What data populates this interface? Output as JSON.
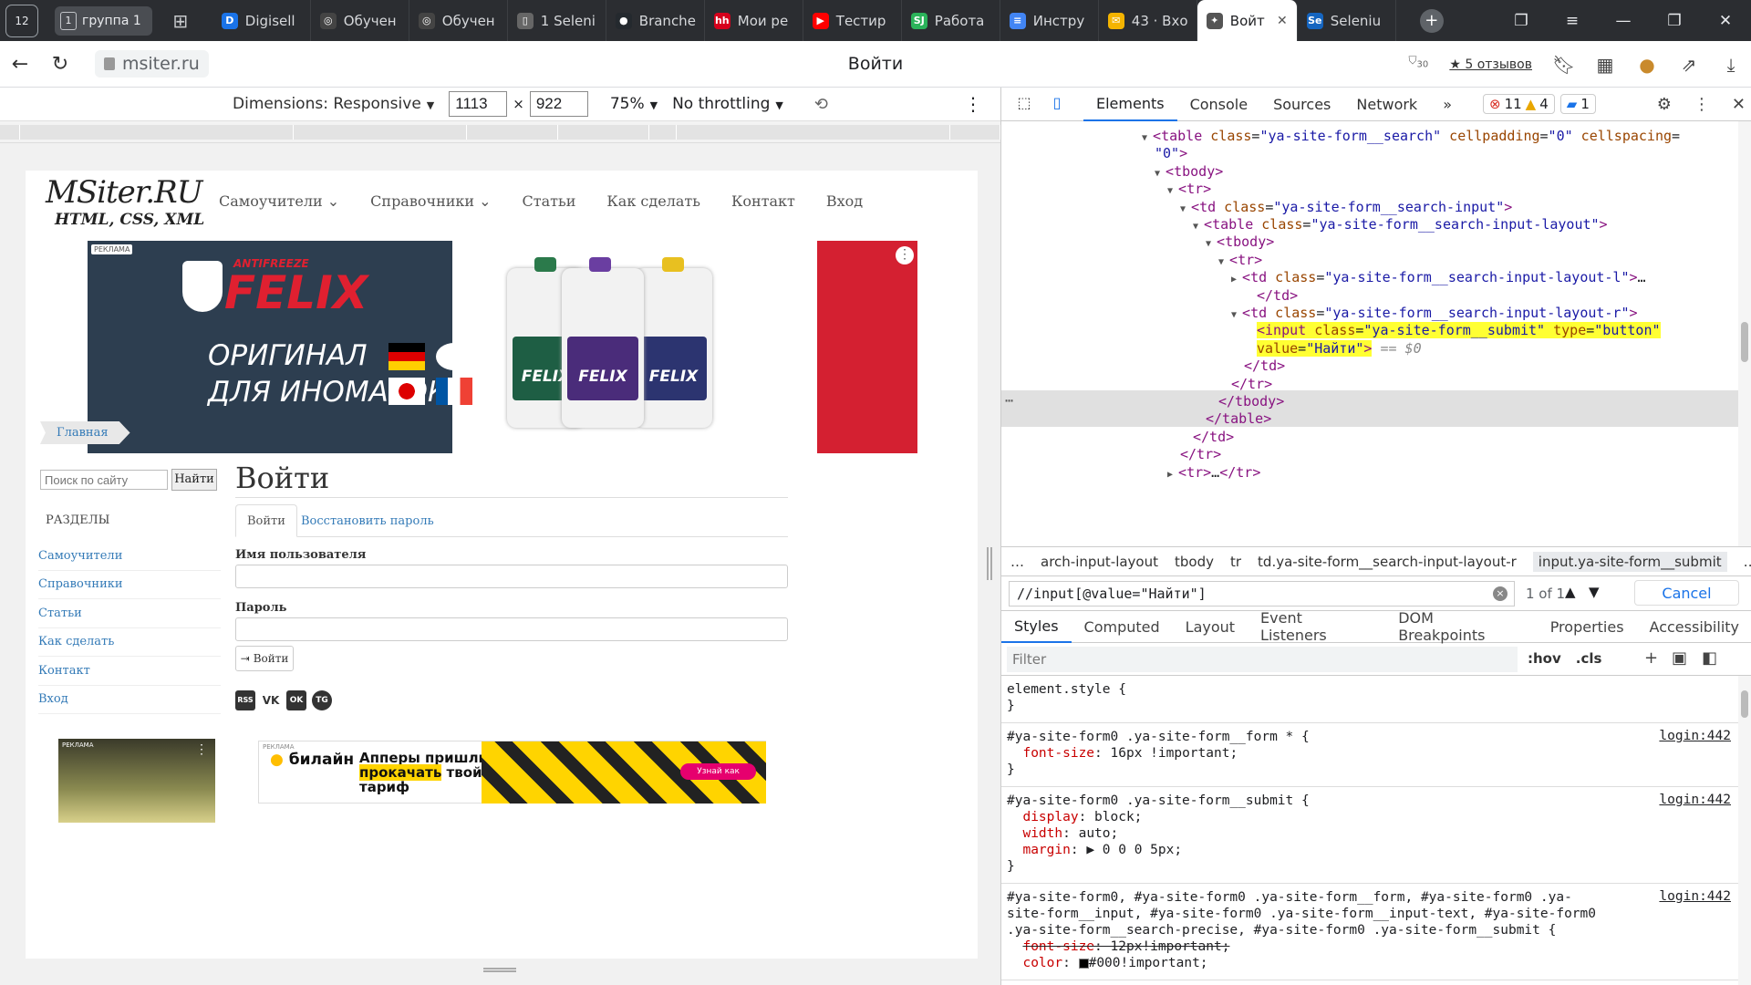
{
  "browser": {
    "home_badge": "12",
    "group": {
      "count": "1",
      "label": "группа 1"
    },
    "tabs": [
      {
        "label": "Digisell",
        "fav": "D",
        "color": "#1a73e8"
      },
      {
        "label": "Обучен",
        "fav": "◎",
        "color": "#444"
      },
      {
        "label": "Обучен",
        "fav": "◎",
        "color": "#444"
      },
      {
        "label": "1 Seleni",
        "fav": "▯",
        "color": "#666"
      },
      {
        "label": "Branche",
        "fav": "●",
        "color": "#24292e"
      },
      {
        "label": "Мои ре",
        "fav": "hh",
        "color": "#d6001c"
      },
      {
        "label": "Тестир",
        "fav": "▶",
        "color": "#ff0000"
      },
      {
        "label": "Работа",
        "fav": "SJ",
        "color": "#2bb35a"
      },
      {
        "label": "Инстру",
        "fav": "≡",
        "color": "#4285f4"
      },
      {
        "label": "43 · Вхо",
        "fav": "✉",
        "color": "#f4b400"
      },
      {
        "label": "Войт",
        "fav": "✦",
        "color": "#555"
      },
      {
        "label": "Seleniu",
        "fav": "Se",
        "color": "#1565c0"
      }
    ],
    "url": "msiter.ru",
    "page_title": "Войти",
    "reviews": "★ 5 отзывов",
    "ext_badge": "30"
  },
  "device_toolbar": {
    "dimensions_label": "Dimensions: Responsive",
    "width": "1113",
    "height": "922",
    "zoom": "75%",
    "throttling": "No throttling",
    "times": "×"
  },
  "site": {
    "logo_line1": "MSiter.RU",
    "logo_line2": "HTML, CSS, XML",
    "menu": [
      "Самоучители ⌄",
      "Справочники ⌄",
      "Статьи",
      "Как сделать",
      "Контакт",
      "Вход"
    ],
    "ad_felix": {
      "reklama": "РЕКЛАМА",
      "antifreeze": "ANTIFREEZE",
      "brand": "FELIX",
      "line1": "ОРИГИНАЛ",
      "line2": "ДЛЯ ИНОМАРОК",
      "bottles": [
        "FELIX",
        "FELIX",
        "FELIX"
      ]
    },
    "breadcrumb": "Главная",
    "search_placeholder": "Поиск по сайту",
    "search_button": "Найти",
    "sections_title": "РАЗДЕЛЫ",
    "side_links": [
      "Самоучители",
      "Справочники",
      "Статьи",
      "Как сделать",
      "Контакт",
      "Вход"
    ],
    "login_heading": "Войти",
    "tab_login": "Войти",
    "tab_restore": "Восстановить пароль",
    "username_label": "Имя пользователя",
    "password_label": "Пароль",
    "login_button": "Войти",
    "socials": [
      "RSS",
      "VK",
      "OK",
      "TG"
    ],
    "ad_beeline": {
      "reklama": "РЕКЛАМА",
      "logo": "билайн",
      "text1": "Апперы пришли",
      "text2a": "прокачать",
      "text2b": " твой",
      "text3": "тариф",
      "cta": "Узнай как"
    },
    "ad_left_reklama": "РЕКЛАМА"
  },
  "devtools": {
    "tabs": [
      "Elements",
      "Console",
      "Sources",
      "Network"
    ],
    "more": "»",
    "errors": "11",
    "warnings": "4",
    "messages": "1",
    "dom_lines": [
      {
        "indent": 0,
        "arrow": "▼",
        "html": "<span class=\"tag\">&lt;table</span> <span class=\"attr\">class</span>=<span class=\"val\">\"ya-site-form__search\"</span> <span class=\"attr\">cellpadding</span>=<span class=\"val\">\"0\"</span> <span class=\"attr\">cellspacing</span>="
      },
      {
        "indent": 0,
        "arrow": "",
        "html": "<span class=\"val\">\"0\"</span><span class=\"tag\">&gt;</span>"
      },
      {
        "indent": 1,
        "arrow": "▼",
        "html": "<span class=\"tag\">&lt;tbody&gt;</span>"
      },
      {
        "indent": 2,
        "arrow": "▼",
        "html": "<span class=\"tag\">&lt;tr&gt;</span>"
      },
      {
        "indent": 3,
        "arrow": "▼",
        "html": "<span class=\"tag\">&lt;td</span> <span class=\"attr\">class</span>=<span class=\"val\">\"ya-site-form__search-input\"</span><span class=\"tag\">&gt;</span>"
      },
      {
        "indent": 4,
        "arrow": "▼",
        "html": "<span class=\"tag\">&lt;table</span> <span class=\"attr\">class</span>=<span class=\"val\">\"ya-site-form__search-input-layout\"</span><span class=\"tag\">&gt;</span>"
      },
      {
        "indent": 5,
        "arrow": "▼",
        "html": "<span class=\"tag\">&lt;tbody&gt;</span>"
      },
      {
        "indent": 6,
        "arrow": "▼",
        "html": "<span class=\"tag\">&lt;tr&gt;</span>"
      },
      {
        "indent": 7,
        "arrow": "▶",
        "html": "<span class=\"tag\">&lt;td</span> <span class=\"attr\">class</span>=<span class=\"val\">\"ya-site-form__search-input-layout-l\"</span><span class=\"tag\">&gt;</span>…"
      },
      {
        "indent": 8,
        "arrow": "",
        "html": "<span class=\"tag\">&lt;/td&gt;</span>"
      },
      {
        "indent": 7,
        "arrow": "▼",
        "html": "<span class=\"tag\">&lt;td</span> <span class=\"attr\">class</span>=<span class=\"val\">\"ya-site-form__search-input-layout-r\"</span><span class=\"tag\">&gt;</span>"
      },
      {
        "indent": 8,
        "arrow": "",
        "html": "<span class=\"hl\"><span class=\"tag\">&lt;input</span> <span class=\"attr\">class</span>=<span class=\"val\">\"ya-site-form__submit\"</span> <span class=\"attr\">type</span>=<span class=\"val\">\"button\"</span></span>"
      },
      {
        "indent": 8,
        "arrow": "",
        "html": "<span class=\"hl\"><span class=\"attr\">value</span>=<span class=\"val\">\"Найти\"</span><span class=\"tag\">&gt;</span></span> <span class=\"eq\">== $0</span>"
      },
      {
        "indent": 7,
        "arrow": "",
        "html": "<span class=\"tag\">&lt;/td&gt;</span>"
      },
      {
        "indent": 6,
        "arrow": "",
        "html": "<span class=\"tag\">&lt;/tr&gt;</span>"
      },
      {
        "indent": 5,
        "arrow": "",
        "html": "<span class=\"tag\">&lt;/tbody&gt;</span>"
      },
      {
        "indent": 4,
        "arrow": "",
        "html": "<span class=\"tag\">&lt;/table&gt;</span>"
      },
      {
        "indent": 3,
        "arrow": "",
        "html": "<span class=\"tag\">&lt;/td&gt;</span>"
      },
      {
        "indent": 2,
        "arrow": "",
        "html": "<span class=\"tag\">&lt;/tr&gt;</span>"
      },
      {
        "indent": 2,
        "arrow": "▶",
        "html": "<span class=\"tag\">&lt;tr&gt;</span>…<span class=\"tag\">&lt;/tr&gt;</span>"
      }
    ],
    "breadcrumbs": [
      "…",
      "arch-input-layout",
      "tbody",
      "tr",
      "td.ya-site-form__search-input-layout-r",
      "input.ya-site-form__submit",
      "…"
    ],
    "search_query": "//input[@value=\"Найти\"]",
    "search_count": "1 of 1",
    "cancel": "Cancel",
    "subtabs": [
      "Styles",
      "Computed",
      "Layout",
      "Event Listeners",
      "DOM Breakpoints",
      "Properties",
      "Accessibility"
    ],
    "filter_placeholder": "Filter",
    "hov": ":hov",
    "cls": ".cls",
    "ellipsis": "⋯",
    "style_rules": [
      {
        "lines": [
          "element.style {",
          "}"
        ],
        "src": ""
      },
      {
        "lines": [
          "#ya-site-form0 .ya-site-form__form * {",
          "  <span class=\"prop\">font-size</span>: 16px !important;",
          "}"
        ],
        "src": "login:442"
      },
      {
        "lines": [
          "#ya-site-form0 .ya-site-form__submit {",
          "  <span class=\"prop\">display</span>: block;",
          "  <span class=\"prop\">width</span>: auto;",
          "  <span class=\"prop\">margin</span>: ▶ 0 0 0 5px;",
          "}"
        ],
        "src": "login:442"
      },
      {
        "lines": [
          "#ya-site-form0, #ya-site-form0 .ya-site-form__form, #ya-site-form0 .ya-",
          "site-form__input, #ya-site-form0 .ya-site-form__input-text, #ya-site-form0",
          ".ya-site-form__search-precise, #ya-site-form0 .ya-site-form__submit {",
          "  <span class=\"strike\"><span class=\"prop\">font-size</span>: 12px!important;</span>",
          "  <span class=\"prop\">color</span>: <span class=\"swatch\"></span>#000!important;"
        ],
        "src": "login:442"
      }
    ]
  }
}
